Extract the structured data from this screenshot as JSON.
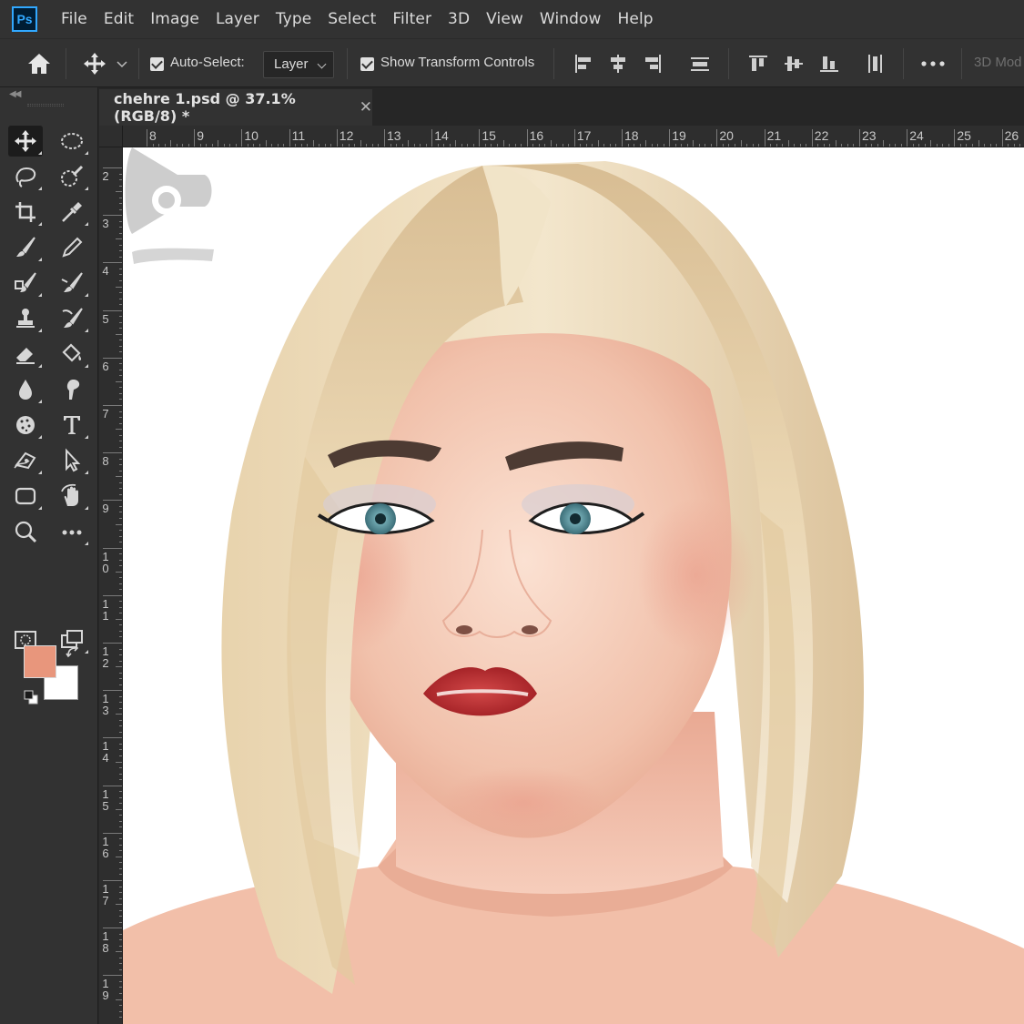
{
  "app": {
    "logo_text": "Ps"
  },
  "menu": [
    "File",
    "Edit",
    "Image",
    "Layer",
    "Type",
    "Select",
    "Filter",
    "3D",
    "View",
    "Window",
    "Help"
  ],
  "options": {
    "auto_select_label": "Auto-Select:",
    "auto_select_checked": true,
    "target_value": "Layer",
    "show_transform_label": "Show Transform Controls",
    "show_transform_checked": true,
    "mode_3d_label": "3D Mod"
  },
  "document": {
    "tab_title": "chehre 1.psd @ 37.1% (RGB/8) *"
  },
  "ruler": {
    "h_labels": [
      "8",
      "9",
      "10",
      "11",
      "12",
      "13",
      "14",
      "15",
      "16",
      "17",
      "18",
      "19",
      "20",
      "21",
      "22",
      "23",
      "24",
      "25",
      "26"
    ],
    "v_labels": [
      "2",
      "3",
      "4",
      "5",
      "6",
      "7",
      "8",
      "9",
      "10",
      "11",
      "12",
      "13",
      "14",
      "15",
      "16",
      "17",
      "18",
      "19"
    ]
  },
  "colors": {
    "foreground": "#e8967c",
    "background": "#ffffff",
    "accent": "#31a8ff"
  },
  "tools": [
    "move-tool-icon",
    "marquee-tool-icon",
    "lasso-tool-icon",
    "quick-select-tool-icon",
    "crop-tool-icon",
    "eyedropper-tool-icon",
    "brush-tool-icon",
    "pencil-tool-icon",
    "clone-brush-tool-icon",
    "history-brush-tool-icon",
    "stamp-tool-icon",
    "mixer-brush-tool-icon",
    "eraser-tool-icon",
    "paint-bucket-tool-icon",
    "blur-tool-icon",
    "smudge-tool-icon",
    "sponge-tool-icon",
    "type-tool-icon",
    "pen-tool-icon",
    "path-select-tool-icon",
    "shape-tool-icon",
    "hand-rotate-tool-icon",
    "zoom-tool-icon",
    "more-tools-icon"
  ]
}
